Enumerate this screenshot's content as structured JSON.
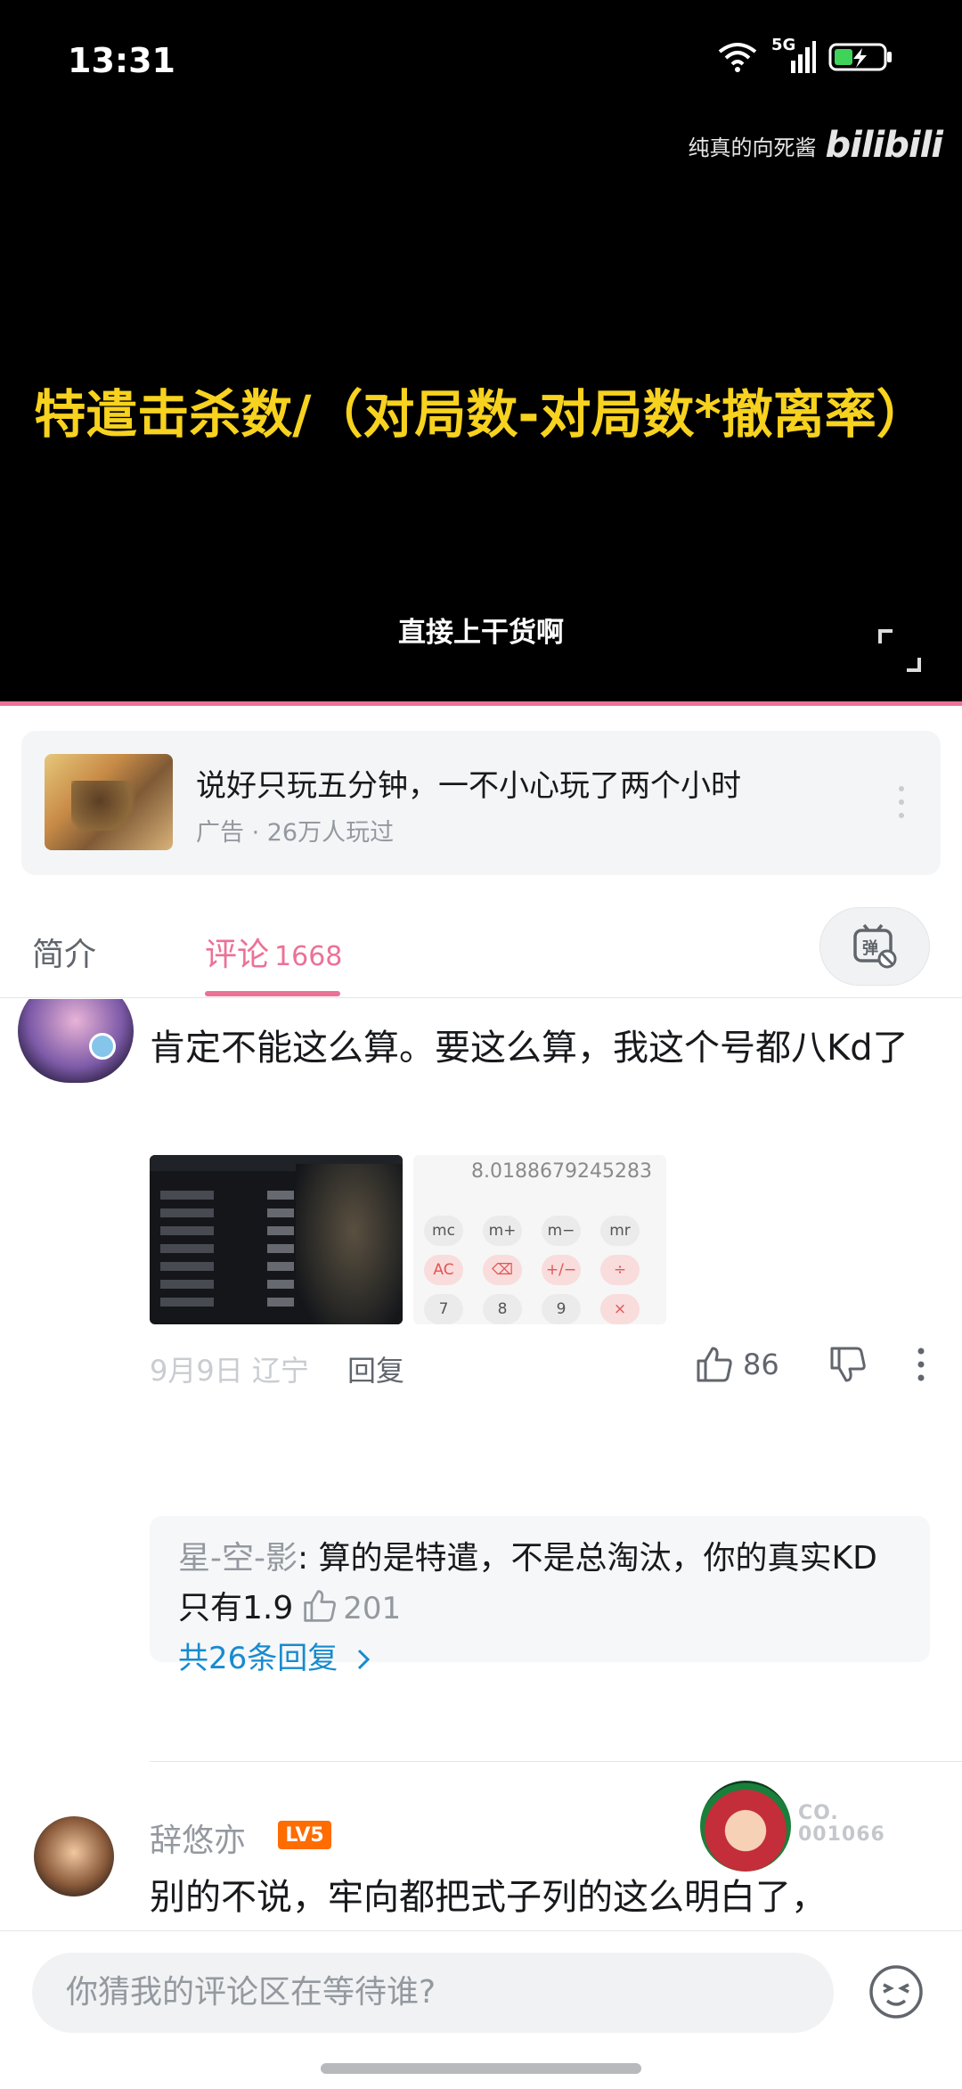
{
  "status_bar": {
    "time": "13:31",
    "network": "5G",
    "icons": [
      "wifi-icon",
      "signal-icon",
      "battery-charging-icon"
    ]
  },
  "video": {
    "watermark_text": "纯真的向死酱",
    "watermark_logo": "bilibili",
    "formula_text": "特遣击杀数/（对局数-对局数*撤离率）",
    "subtitle": "直接上干货啊",
    "accent_color": "#ec7197"
  },
  "ad": {
    "title": "说好只玩五分钟，一不小心玩了两个小时",
    "subtitle": "广告 · 26万人玩过"
  },
  "tabs": {
    "intro_label": "简介",
    "comments_label": "评论",
    "comments_count": "1668",
    "danmaku_icon": "danmaku-off-icon"
  },
  "comment1": {
    "text": "肯定不能这么算。要这么算，我这个号都八Kd了",
    "meta": "9月9日 辽宁",
    "reply_label": "回复",
    "like_count": "86",
    "screenshot2": {
      "calc_value": "8.0188679245283",
      "keys": [
        "mc",
        "m+",
        "m−",
        "mr",
        "AC",
        "⌫",
        "+/−",
        "÷",
        "7",
        "8",
        "9",
        "×"
      ]
    },
    "reply": {
      "user": "星-空-影",
      "text": ": 算的是特遣，不是总淘汰，你的真实KD只有1.9",
      "like_count": "201",
      "total_label": "共26条回复"
    }
  },
  "comment2": {
    "username": "辞悠亦",
    "level": "LV5",
    "fan_number": "CO.\n001066",
    "text": "别的不说，牢向都把式子列的这么明白了，"
  },
  "input": {
    "placeholder": "你猜我的评论区在等待谁?"
  }
}
